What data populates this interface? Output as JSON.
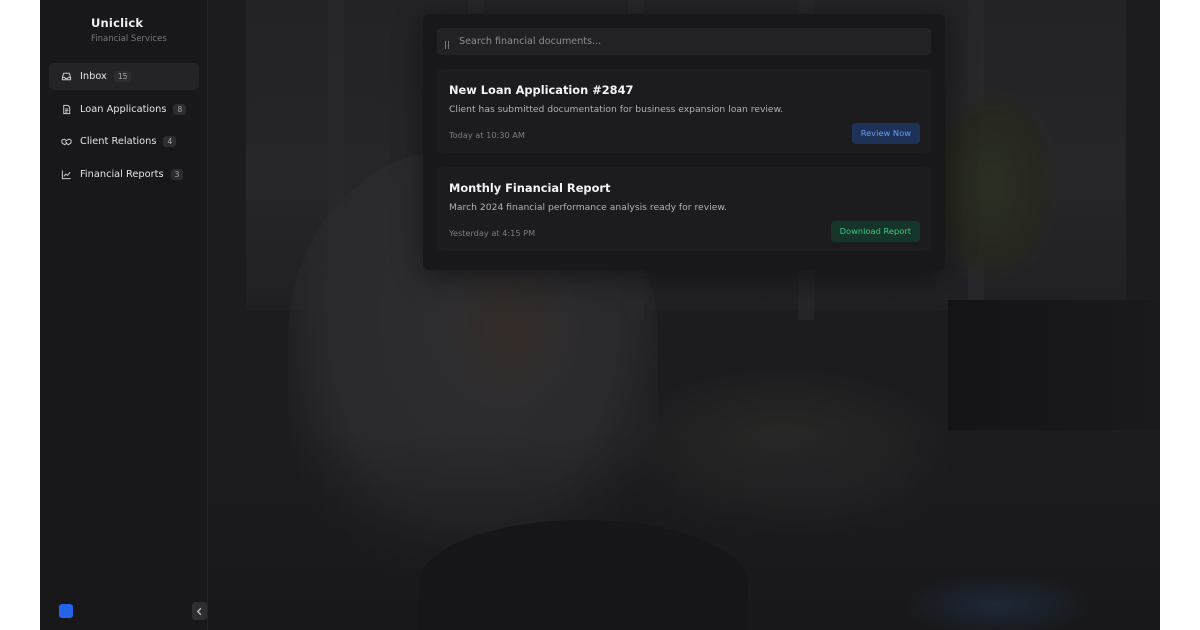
{
  "brand": {
    "name": "Uniclick",
    "subtitle": "Financial Services"
  },
  "sidebar": {
    "items": [
      {
        "label": "Inbox",
        "count": "15",
        "icon": "inbox-icon",
        "active": true
      },
      {
        "label": "Loan Applications",
        "count": "8",
        "icon": "document-icon",
        "active": false
      },
      {
        "label": "Client Relations",
        "count": "4",
        "icon": "handshake-icon",
        "active": false
      },
      {
        "label": "Financial Reports",
        "count": "3",
        "icon": "chart-line-icon",
        "active": false
      }
    ],
    "avatar_color": "#2563eb",
    "collapse_icon": "chevron-left-icon"
  },
  "search": {
    "placeholder": "Search financial documents...",
    "icon": "search-icon"
  },
  "cards": [
    {
      "title": "New Loan Application #2847",
      "description": "Client has submitted documentation for business expansion loan review.",
      "time": "Today at 10:30 AM",
      "action": "Review Now",
      "action_color": "#6e9cf2"
    },
    {
      "title": "Monthly Financial Report",
      "description": "March 2024 financial performance analysis ready for review.",
      "time": "Yesterday at 4:15 PM",
      "action": "Download Report",
      "action_color": "#3ec487"
    }
  ]
}
